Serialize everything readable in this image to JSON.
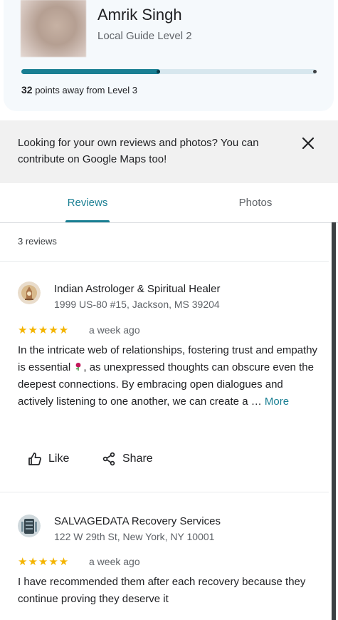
{
  "profile": {
    "name": "Amrik Singh",
    "level": "Local Guide Level 2",
    "points_away": "32",
    "points_suffix": " points away from Level 3",
    "progress_fraction": 0.47
  },
  "banner": {
    "text": "Looking for your own reviews and photos? You can contribute on Google Maps too!",
    "close_icon": "close-icon"
  },
  "tabs": [
    {
      "label": "Reviews",
      "active": true
    },
    {
      "label": "Photos",
      "active": false
    }
  ],
  "review_count": "3 reviews",
  "reviews": [
    {
      "business": "Indian Astrologer & Spiritual Healer",
      "address": "1999 US-80 #15, Jackson, MS 39204",
      "stars": "★★★★★",
      "rating": 5,
      "time": "a week ago",
      "text_part1": "In the intricate web of relationships, fostering trust and empathy is essential ",
      "text_part2": ", as unexpressed thoughts can obscure even the deepest connections. By embracing open dialogues and actively listening to one another, we can create a … ",
      "more": "More",
      "emoji_icon": "rose-icon"
    },
    {
      "business": "SALVAGEDATA Recovery Services",
      "address": "122 W 29th St, New York, NY 10001",
      "stars": "★★★★★",
      "rating": 5,
      "time": "a week ago",
      "text": "I have recommended them after each recovery because they continue proving they deserve it"
    }
  ],
  "actions": {
    "like": "Like",
    "share": "Share"
  },
  "colors": {
    "accent": "#1a7f93",
    "star": "#f4b400",
    "banner_bg": "#f1f1f1"
  }
}
